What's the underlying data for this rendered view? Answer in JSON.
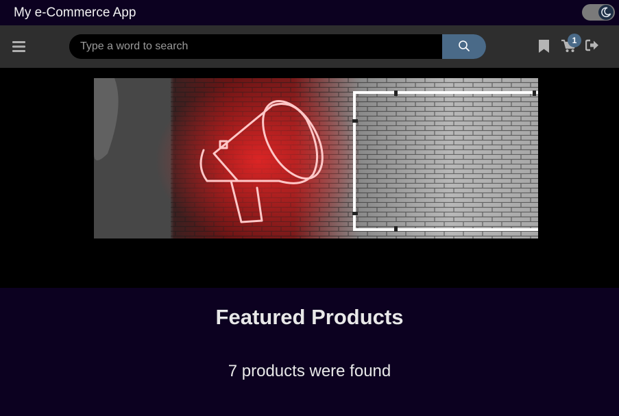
{
  "app": {
    "title": "My e-Commerce App"
  },
  "theme_toggle": {
    "icon": "moon-icon",
    "state": "dark"
  },
  "navbar": {
    "menu_icon": "hamburger-menu-icon",
    "search": {
      "placeholder": "Type a word to search",
      "value": "",
      "button_icon": "search-icon"
    },
    "bookmark_icon": "bookmark-icon",
    "cart": {
      "icon": "cart-icon",
      "badge": "1"
    },
    "logout_icon": "sign-out-icon",
    "accent_color": "#4a6a88"
  },
  "banner": {
    "image": "neon-megaphone-on-brick-wall"
  },
  "featured": {
    "title": "Featured Products",
    "count_text": "7 products were found"
  }
}
